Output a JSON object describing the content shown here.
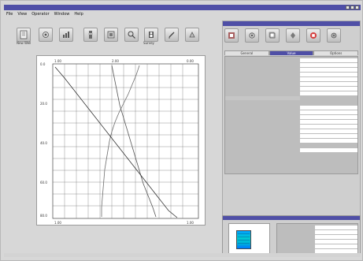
{
  "window": {
    "title": "",
    "controls": [
      "minimize",
      "maximize",
      "close"
    ]
  },
  "menu": {
    "items": [
      "File",
      "View",
      "Operator",
      "Window",
      "Help"
    ]
  },
  "toolbar": {
    "buttons": [
      {
        "name": "new-well-icon",
        "label": "New Well"
      },
      {
        "name": "open-icon",
        "label": ""
      },
      {
        "name": "chart-icon",
        "label": ""
      },
      {
        "name": "tool-icon",
        "label": ""
      },
      {
        "name": "zoom-icon",
        "label": ""
      },
      {
        "name": "survey-icon",
        "label": "Survey"
      },
      {
        "name": "edit-icon",
        "label": ""
      },
      {
        "name": "marker-icon",
        "label": ""
      }
    ]
  },
  "chart": {
    "x_min_left": "1.00",
    "x_mid_left": "2.00",
    "x_min_right": "0.00",
    "x_mid_right": "1.00",
    "bottom_left": "1.00",
    "bottom_right": "1.00",
    "y_labels": [
      "0.0",
      "20.0",
      "40.0",
      "60.0",
      "80.0"
    ],
    "grid": true,
    "line_colors": [
      "#555555",
      "#6d6d6d",
      "#222222"
    ]
  },
  "right_panel": {
    "title": "",
    "toolbar": [
      {
        "name": "properties-icon",
        "label": ""
      },
      {
        "name": "settings-icon",
        "label": ""
      },
      {
        "name": "copy-icon",
        "label": ""
      },
      {
        "name": "pin-icon",
        "label": ""
      },
      {
        "name": "stop-icon",
        "label": ""
      },
      {
        "name": "gear-icon",
        "label": ""
      }
    ],
    "tabs": [
      "General",
      "Value",
      "Options"
    ],
    "active_tab": 1,
    "rows": [
      {
        "label": "",
        "value": ""
      },
      {
        "label": "",
        "value": ""
      },
      {
        "label": "",
        "value": ""
      },
      {
        "label": "",
        "value": ""
      },
      {
        "label": "",
        "value": ""
      },
      {
        "label": "",
        "value": ""
      },
      {
        "label": "",
        "value": ""
      },
      {
        "label": "",
        "value": ""
      },
      {
        "label": "",
        "value": ""
      },
      {
        "label": "",
        "value": ""
      },
      {
        "label": "",
        "value": ""
      },
      {
        "label": "",
        "value": ""
      },
      {
        "label": "",
        "value": ""
      },
      {
        "label": "",
        "value": ""
      },
      {
        "label": "",
        "value": ""
      },
      {
        "label": "",
        "value": ""
      },
      {
        "label": "",
        "value": ""
      },
      {
        "label": "",
        "value": ""
      }
    ]
  },
  "bottom_panel": {
    "title": "",
    "rows": [
      {
        "label": "",
        "value": ""
      },
      {
        "label": "",
        "value": ""
      },
      {
        "label": "",
        "value": ""
      },
      {
        "label": "",
        "value": ""
      },
      {
        "label": "",
        "value": ""
      },
      {
        "label": "",
        "value": ""
      }
    ]
  }
}
